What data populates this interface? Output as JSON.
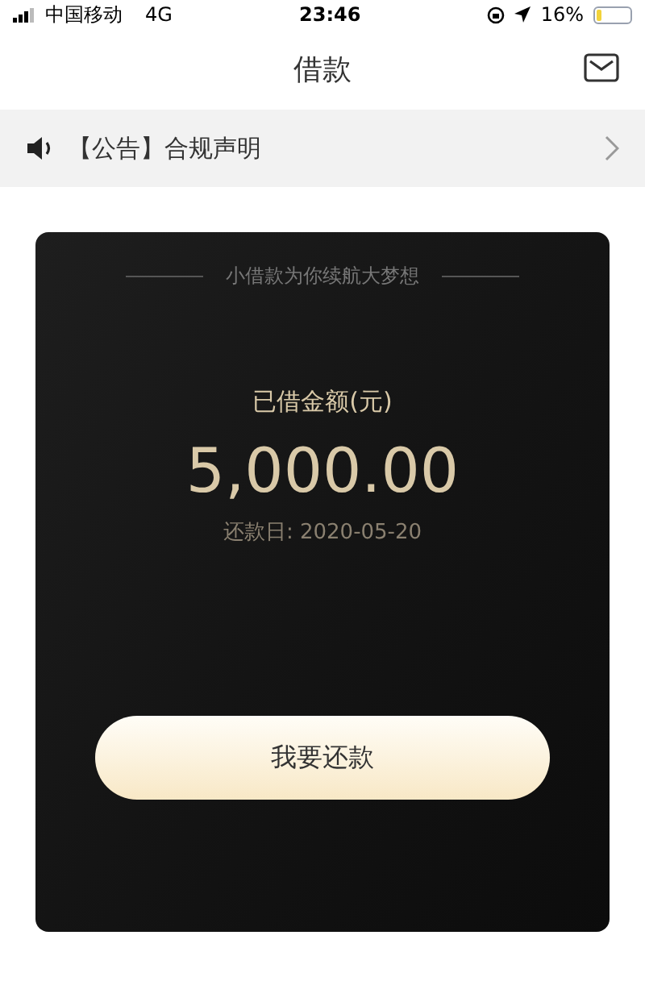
{
  "status_bar": {
    "carrier": "中国移动",
    "network": "4G",
    "time": "23:46",
    "battery_percent": "16%",
    "battery": {
      "level": 0.16
    }
  },
  "nav_bar": {
    "title": "借款"
  },
  "notice": {
    "text": "【公告】合规声明"
  },
  "loan_card": {
    "slogan": "小借款为你续航大梦想",
    "amount_label": "已借金额(元)",
    "amount": "5,000.00",
    "due_date": "还款日: 2020-05-20",
    "button": "我要还款"
  }
}
